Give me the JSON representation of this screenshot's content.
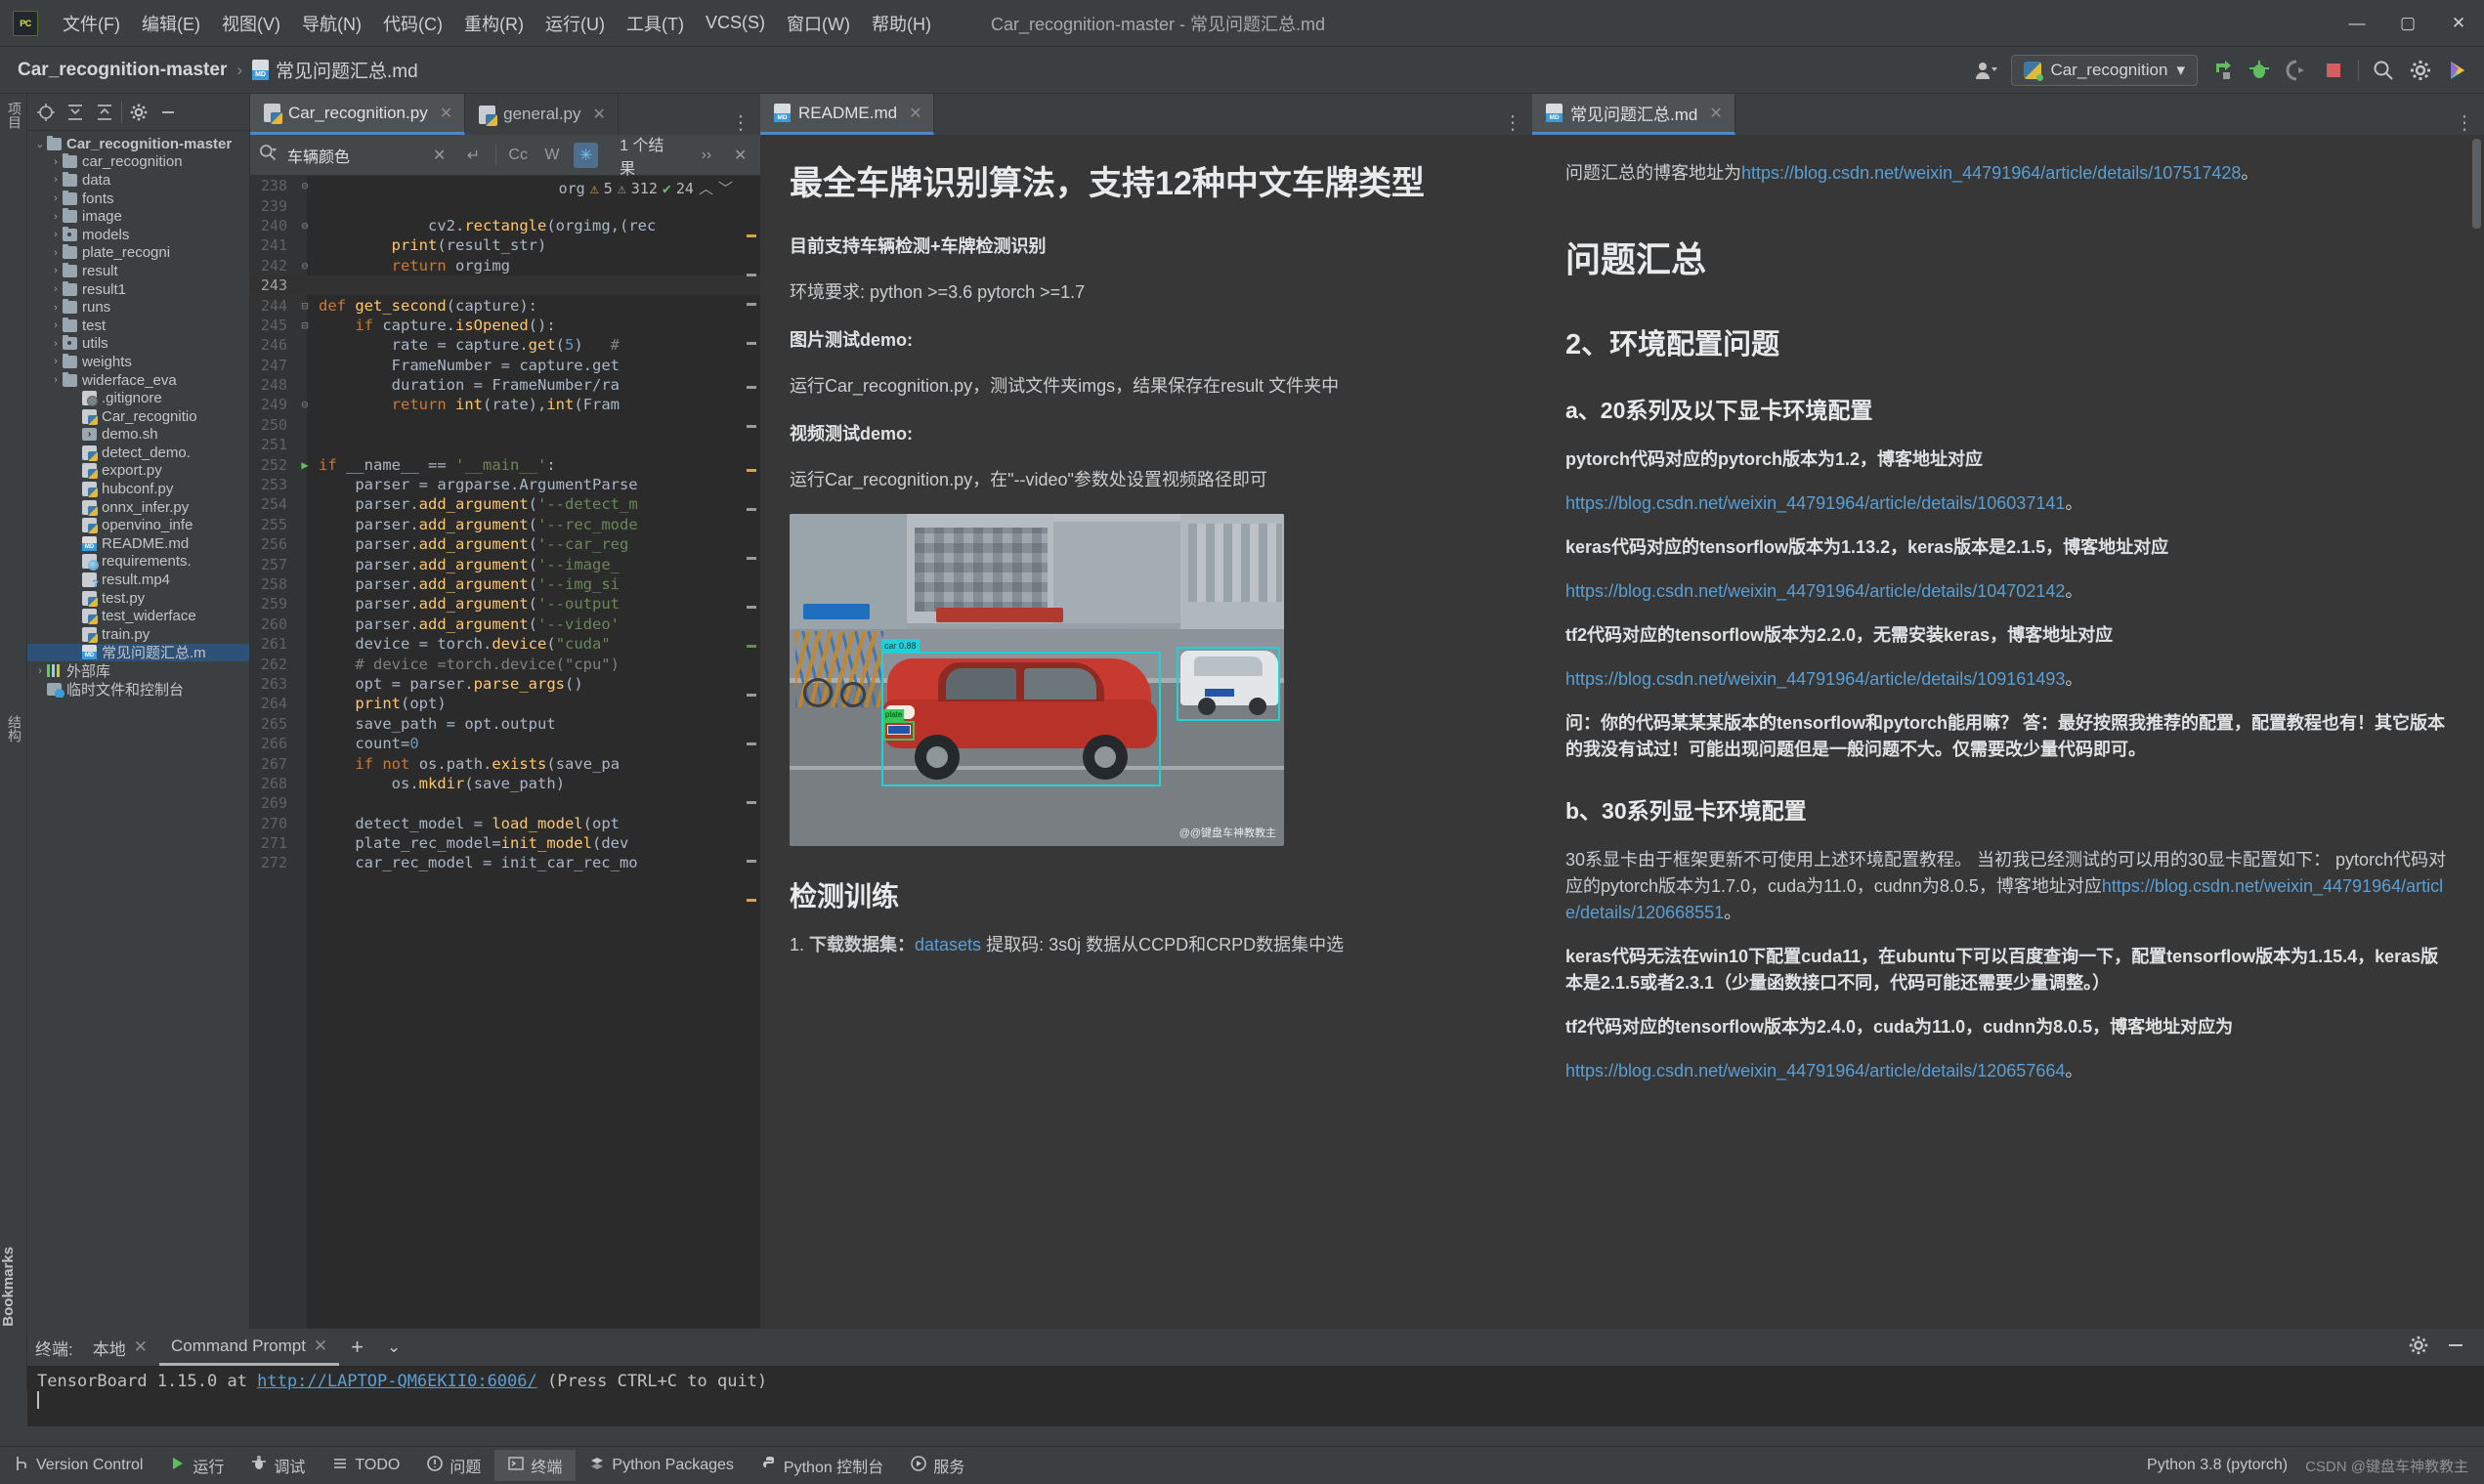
{
  "window": {
    "title": "Car_recognition-master - 常见问题汇总.md",
    "logo": "PC",
    "minimize": "—",
    "maximize": "▢",
    "close": "✕"
  },
  "menu": [
    {
      "label": "文件(F)"
    },
    {
      "label": "编辑(E)"
    },
    {
      "label": "视图(V)"
    },
    {
      "label": "导航(N)"
    },
    {
      "label": "代码(C)"
    },
    {
      "label": "重构(R)"
    },
    {
      "label": "运行(U)"
    },
    {
      "label": "工具(T)"
    },
    {
      "label": "VCS(S)"
    },
    {
      "label": "窗口(W)"
    },
    {
      "label": "帮助(H)"
    }
  ],
  "breadcrumb": {
    "root": "Car_recognition-master",
    "sep": "›",
    "file": "常见问题汇总.md"
  },
  "navbar_right": {
    "run_config": "Car_recognition",
    "dropdown": "▾",
    "icons": [
      "run-icon",
      "debug-icon",
      "coverage-icon",
      "stop-icon",
      "search-icon",
      "settings-icon",
      "ai-icon"
    ]
  },
  "left_strip": {
    "project_label": "项目",
    "structure_label": "结构",
    "bookmarks_label": "Bookmarks"
  },
  "project": {
    "toolbar_icons": [
      "locate-icon",
      "expand-all-icon",
      "collapse-all-icon",
      "settings-icon",
      "hide-icon"
    ],
    "tree": [
      {
        "label": "Car_recognition-master",
        "type": "folder-root",
        "indent": 0,
        "arrow": "⌄",
        "selected": false
      },
      {
        "label": "car_recognition",
        "type": "folder",
        "indent": 1,
        "arrow": "›",
        "selected": false
      },
      {
        "label": "data",
        "type": "folder",
        "indent": 1,
        "arrow": "›",
        "selected": false
      },
      {
        "label": "fonts",
        "type": "folder",
        "indent": 1,
        "arrow": "›",
        "selected": false
      },
      {
        "label": "image",
        "type": "folder",
        "indent": 1,
        "arrow": "›",
        "selected": false
      },
      {
        "label": "models",
        "type": "folder-src",
        "indent": 1,
        "arrow": "›",
        "selected": false
      },
      {
        "label": "plate_recogni",
        "type": "folder",
        "indent": 1,
        "arrow": "›",
        "selected": false
      },
      {
        "label": "result",
        "type": "folder",
        "indent": 1,
        "arrow": "›",
        "selected": false
      },
      {
        "label": "result1",
        "type": "folder",
        "indent": 1,
        "arrow": "›",
        "selected": false
      },
      {
        "label": "runs",
        "type": "folder",
        "indent": 1,
        "arrow": "›",
        "selected": false
      },
      {
        "label": "test",
        "type": "folder",
        "indent": 1,
        "arrow": "›",
        "selected": false
      },
      {
        "label": "utils",
        "type": "folder-src",
        "indent": 1,
        "arrow": "›",
        "selected": false
      },
      {
        "label": "weights",
        "type": "folder",
        "indent": 1,
        "arrow": "›",
        "selected": false
      },
      {
        "label": "widerface_eva",
        "type": "folder",
        "indent": 1,
        "arrow": "›",
        "selected": false
      },
      {
        "label": ".gitignore",
        "type": "git",
        "indent": 2,
        "arrow": "",
        "selected": false
      },
      {
        "label": "Car_recognitio",
        "type": "py",
        "indent": 2,
        "arrow": "",
        "selected": false
      },
      {
        "label": "demo.sh",
        "type": "sh",
        "indent": 2,
        "arrow": "",
        "selected": false
      },
      {
        "label": "detect_demo.",
        "type": "py",
        "indent": 2,
        "arrow": "",
        "selected": false
      },
      {
        "label": "export.py",
        "type": "py",
        "indent": 2,
        "arrow": "",
        "selected": false
      },
      {
        "label": "hubconf.py",
        "type": "py",
        "indent": 2,
        "arrow": "",
        "selected": false
      },
      {
        "label": "onnx_infer.py",
        "type": "py",
        "indent": 2,
        "arrow": "",
        "selected": false
      },
      {
        "label": "openvino_infe",
        "type": "py",
        "indent": 2,
        "arrow": "",
        "selected": false
      },
      {
        "label": "README.md",
        "type": "md",
        "indent": 2,
        "arrow": "",
        "selected": false
      },
      {
        "label": "requirements.",
        "type": "txt",
        "indent": 2,
        "arrow": "",
        "selected": false
      },
      {
        "label": "result.mp4",
        "type": "mp4",
        "indent": 2,
        "arrow": "",
        "selected": false
      },
      {
        "label": "test.py",
        "type": "py",
        "indent": 2,
        "arrow": "",
        "selected": false
      },
      {
        "label": "test_widerface",
        "type": "py",
        "indent": 2,
        "arrow": "",
        "selected": false
      },
      {
        "label": "train.py",
        "type": "py",
        "indent": 2,
        "arrow": "",
        "selected": false
      },
      {
        "label": "常见问题汇总.m",
        "type": "md",
        "indent": 2,
        "arrow": "",
        "selected": true
      },
      {
        "label": "外部库",
        "type": "lib",
        "indent": 0,
        "arrow": "›",
        "selected": false
      },
      {
        "label": "临时文件和控制台",
        "type": "clock",
        "indent": 0,
        "arrow": "",
        "selected": false
      }
    ]
  },
  "editor": {
    "tabs": [
      {
        "label": "Car_recognition.py",
        "icon": "python-file-icon",
        "active": true,
        "close": "✕"
      },
      {
        "label": "general.py",
        "icon": "python-file-icon",
        "active": false,
        "close": "✕"
      }
    ],
    "more": "⋮",
    "find": {
      "value": "车辆颜色",
      "clear": "✕",
      "history": "↵",
      "match_case": "Cc",
      "words": "W",
      "regex": "✳",
      "results": "1 个结果",
      "next": "››",
      "close": "✕"
    },
    "inspection": {
      "word": "org",
      "warnings": "5",
      "weak_warnings": "312",
      "checks": "24",
      "up": "︿",
      "down": "﹀"
    },
    "lines": [
      {
        "n": "238",
        "code": "",
        "fold": "⊖"
      },
      {
        "n": "239",
        "code": "",
        "fold": ""
      },
      {
        "n": "240",
        "code": "            cv2.rectangle(orgimg,(rec",
        "fold": "⊖"
      },
      {
        "n": "241",
        "code": "        print(result_str)",
        "fold": ""
      },
      {
        "n": "242",
        "code": "        return orgimg",
        "fold": "⊖"
      },
      {
        "n": "243",
        "code": "",
        "fold": "",
        "current": true
      },
      {
        "n": "244",
        "code": "def get_second(capture):",
        "fold": "⊟"
      },
      {
        "n": "245",
        "code": "    if capture.isOpened():",
        "fold": "⊟"
      },
      {
        "n": "246",
        "code": "        rate = capture.get(5)   #",
        "fold": ""
      },
      {
        "n": "247",
        "code": "        FrameNumber = capture.get",
        "fold": ""
      },
      {
        "n": "248",
        "code": "        duration = FrameNumber/ra",
        "fold": ""
      },
      {
        "n": "249",
        "code": "        return int(rate),int(Fram",
        "fold": "⊖"
      },
      {
        "n": "250",
        "code": "",
        "fold": ""
      },
      {
        "n": "251",
        "code": "",
        "fold": ""
      },
      {
        "n": "252",
        "code": "if __name__ == '__main__':",
        "fold": "⊟",
        "run": "▶"
      },
      {
        "n": "253",
        "code": "    parser = argparse.ArgumentParse",
        "fold": ""
      },
      {
        "n": "254",
        "code": "    parser.add_argument('--detect_m",
        "fold": ""
      },
      {
        "n": "255",
        "code": "    parser.add_argument('--rec_mode",
        "fold": ""
      },
      {
        "n": "256",
        "code": "    parser.add_argument('--car_reg",
        "fold": ""
      },
      {
        "n": "257",
        "code": "    parser.add_argument('--image_",
        "fold": ""
      },
      {
        "n": "258",
        "code": "    parser.add_argument('--img_si",
        "fold": ""
      },
      {
        "n": "259",
        "code": "    parser.add_argument('--output",
        "fold": ""
      },
      {
        "n": "260",
        "code": "    parser.add_argument('--video'",
        "fold": ""
      },
      {
        "n": "261",
        "code": "    device = torch.device(\"cuda\"",
        "fold": ""
      },
      {
        "n": "262",
        "code": "    # device =torch.device(\"cpu\")",
        "fold": ""
      },
      {
        "n": "263",
        "code": "    opt = parser.parse_args()",
        "fold": ""
      },
      {
        "n": "264",
        "code": "    print(opt)",
        "fold": ""
      },
      {
        "n": "265",
        "code": "    save_path = opt.output",
        "fold": ""
      },
      {
        "n": "266",
        "code": "    count=0",
        "fold": ""
      },
      {
        "n": "267",
        "code": "    if not os.path.exists(save_pa",
        "fold": ""
      },
      {
        "n": "268",
        "code": "        os.mkdir(save_path)",
        "fold": ""
      },
      {
        "n": "269",
        "code": "",
        "fold": ""
      },
      {
        "n": "270",
        "code": "    detect_model = load_model(opt",
        "fold": ""
      },
      {
        "n": "271",
        "code": "    plate_rec_model=init_model(dev",
        "fold": ""
      },
      {
        "n": "272",
        "code": "    car_rec_model = init_car_rec_mo",
        "fold": ""
      }
    ]
  },
  "md_preview": {
    "tab": {
      "label": "README.md",
      "icon": "markdown-file-icon",
      "close": "✕",
      "more": "⋮"
    },
    "h1": "最全车牌识别算法，支持12种中文车牌类型",
    "bold1": "目前支持车辆检测+车牌检测识别",
    "p1": "环境要求: python >=3.6 pytorch >=1.7",
    "bold2": "图片测试demo:",
    "p2": "运行Car_recognition.py，测试文件夹imgs，结果保存在result 文件夹中",
    "bold3": "视频测试demo:",
    "p3": "运行Car_recognition.py，在\"--video\"参数处设置视频路径即可",
    "image_watermark": "@@键盘车神教教主",
    "image_labels": [
      "car 0.88",
      "plate"
    ],
    "h2": "检测训练",
    "list_item1_prefix": "1. ",
    "list_item1_bold": "下载数据集：",
    "list_item1_link": "datasets",
    "list_item1_rest": " 提取码: 3s0j 数据从CCPD和CRPD数据集中选"
  },
  "right_panel": {
    "tab": {
      "label": "常见问题汇总.md",
      "icon": "markdown-file-icon",
      "close": "✕",
      "more": "⋮"
    },
    "intro_prefix": "问题汇总的博客地址为",
    "intro_link": "https://blog.csdn.net/weixin_44791964/article/details/107517428",
    "intro_suffix": "。",
    "h1": "问题汇总",
    "h2": "2、环境配置问题",
    "h3_a": "a、20系列及以下显卡环境配置",
    "b1": "pytorch代码对应的pytorch版本为1.2，博客地址对应",
    "l1": "https://blog.csdn.net/weixin_44791964/article/details/106037141",
    "b2": "keras代码对应的tensorflow版本为1.13.2，keras版本是2.1.5，博客地址对应",
    "l2": "https://blog.csdn.net/weixin_44791964/article/details/104702142",
    "b3": "tf2代码对应的tensorflow版本为2.2.0，无需安装keras，博客地址对应",
    "l3": "https://blog.csdn.net/weixin_44791964/article/details/109161493",
    "qa": "问：你的代码某某某版本的tensorflow和pytorch能用嘛？ 答：最好按照我推荐的配置，配置教程也有！其它版本的我没有试过！可能出现问题但是一般问题不大。仅需要改少量代码即可。",
    "h3_b": "b、30系列显卡环境配置",
    "p_b1": "30系显卡由于框架更新不可使用上述环境配置教程。 当初我已经测试的可以用的30显卡配置如下： pytorch代码对应的pytorch版本为1.7.0，cuda为11.0，cudnn为8.0.5，博客地址对应",
    "l4": "https://blog.csdn.net/weixin_44791964/article/details/120668551",
    "p_b2": "keras代码无法在win10下配置cuda11，在ubuntu下可以百度查询一下，配置tensorflow版本为1.15.4，keras版本是2.1.5或者2.3.1（少量函数接口不同，代码可能还需要少量调整。）",
    "p_b3": "tf2代码对应的tensorflow版本为2.4.0，cuda为11.0，cudnn为8.0.5，博客地址对应为",
    "l5": "https://blog.csdn.net/weixin_44791964/article/details/120657664",
    "suffix": "。"
  },
  "terminal": {
    "label": "终端:",
    "tabs": [
      {
        "label": "本地",
        "close": "✕",
        "active": false
      },
      {
        "label": "Command Prompt",
        "close": "✕",
        "active": true
      }
    ],
    "add": "+",
    "dropdown": "⌄",
    "settings_icon": "gear-icon",
    "minimize_icon": "minimize-icon",
    "output_prefix": "TensorBoard 1.15.0 at ",
    "output_link": "http://LAPTOP-QM6EKII0:6006/",
    "output_suffix": " (Press CTRL+C to quit)"
  },
  "statusbar": {
    "items": [
      {
        "label": "Version Control",
        "icon": "branch-icon",
        "active": false
      },
      {
        "label": "运行",
        "icon": "run-icon",
        "active": false
      },
      {
        "label": "调试",
        "icon": "bug-icon",
        "active": false
      },
      {
        "label": "TODO",
        "icon": "list-icon",
        "active": false
      },
      {
        "label": "问题",
        "icon": "warning-icon",
        "active": false
      },
      {
        "label": "终端",
        "icon": "terminal-icon",
        "active": true
      },
      {
        "label": "Python Packages",
        "icon": "packages-icon",
        "active": false
      },
      {
        "label": "Python 控制台",
        "icon": "python-icon",
        "active": false
      },
      {
        "label": "服务",
        "icon": "services-icon",
        "active": false
      }
    ],
    "interpreter": "Python 3.8 (pytorch)",
    "watermark": "CSDN @键盘车神教教主"
  },
  "colors": {
    "accent": "#4a88c7",
    "link": "#5a9fd4",
    "bg_chrome": "#3c3f41",
    "bg_editor": "#2b2b2b",
    "bg_preview": "#373737",
    "selection": "#2d5177",
    "warning": "#d9a343",
    "success": "#5fbf5f",
    "stop": "#d35f5f"
  }
}
